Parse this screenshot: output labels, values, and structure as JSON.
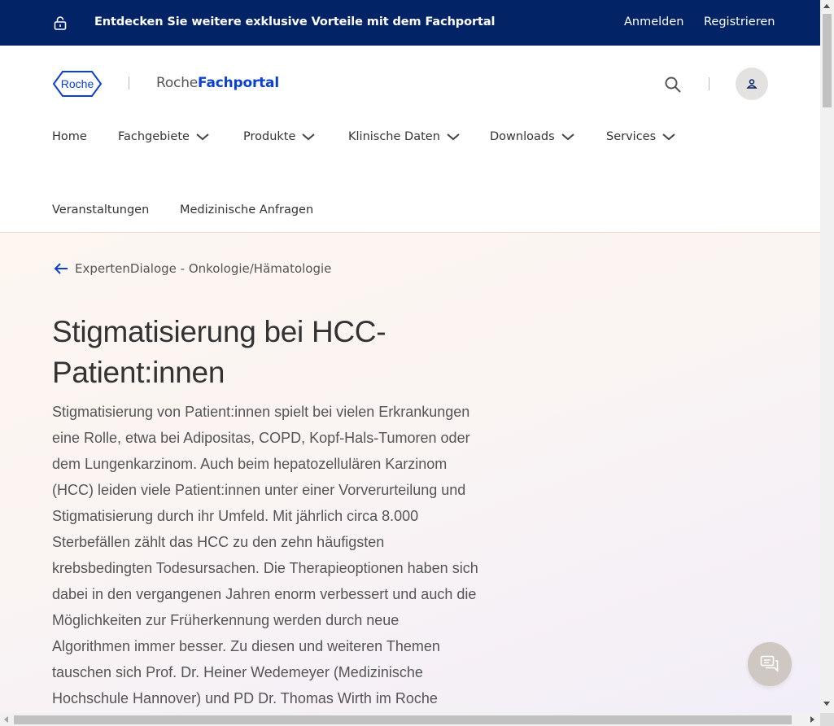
{
  "promo_bar": {
    "text": "Entdecken Sie weitere exklusive Vorteile mit dem Fachportal",
    "login_label": "Anmelden",
    "register_label": "Registrieren",
    "background": "#022366",
    "icon": "lock-open-icon"
  },
  "header": {
    "logo_text": "Roche",
    "brand_prefix": "Roche",
    "brand_suffix": "Fachportal",
    "brand_color": "#0b41cd",
    "search_icon": "search-icon",
    "user_icon": "user-icon"
  },
  "nav": {
    "items": [
      {
        "label": "Home",
        "has_dropdown": false
      },
      {
        "label": "Fachgebiete",
        "has_dropdown": true
      },
      {
        "label": "Produkte",
        "has_dropdown": true
      },
      {
        "label": "Klinische Daten",
        "has_dropdown": true
      },
      {
        "label": "Downloads",
        "has_dropdown": true
      },
      {
        "label": "Services",
        "has_dropdown": true
      },
      {
        "label": "Veranstaltungen",
        "has_dropdown": false
      },
      {
        "label": "Medizinische Anfragen",
        "has_dropdown": false
      }
    ]
  },
  "article": {
    "back_link": "ExpertenDialoge - Onkologie/Hämatologie",
    "title": "Stigmatisierung bei HCC-Patient:innen",
    "intro": "Stigmatisierung von Patient:innen spielt bei vielen Erkrankungen eine Rolle, etwa bei Adipositas, COPD, Kopf-Hals-Tumoren oder dem Lungenkarzinom. Auch beim hepatozellulären Karzinom (HCC) leiden viele Patient:innen unter einer Vorverurteilung und Stigmatisierung durch ihr Umfeld. Mit jährlich circa 8.000 Sterbefällen zählt das HCC zu den zehn häufigsten krebsbedingten Todesursachen. Die Therapieoptionen haben sich dabei in den vergangenen Jahren enorm verbessert und auch die Möglichkeiten zur Früherkennung werden durch neue Algorithmen immer besser. Zu diesen und weiteren Themen tauschen sich Prof. Dr. Heiner Wedemeyer (Medizinische Hochschule Hannover) und PD Dr. Thomas Wirth im Roche"
  },
  "chat_button": {
    "icon": "chat-icon"
  }
}
